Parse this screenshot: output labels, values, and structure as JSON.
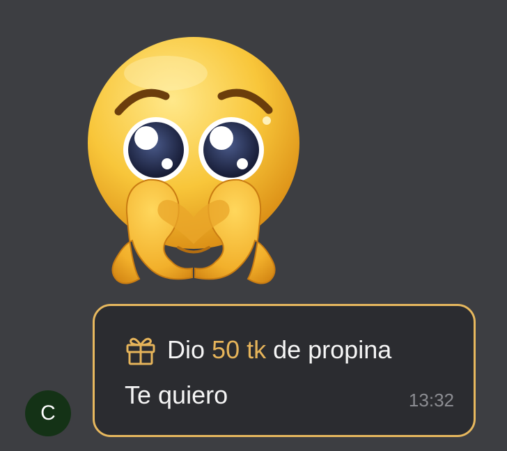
{
  "sticker": {
    "icon": "pleading-face-heart-hands-emoji"
  },
  "avatar": {
    "initial": "C",
    "color": "#143216"
  },
  "bubble": {
    "border_color": "#e7b85e",
    "gift_icon": "gift-icon",
    "tip_prefix": "Dio",
    "tip_amount": "50 tk",
    "tip_suffix": "de propina",
    "message": "Te quiero",
    "time": "13:32"
  },
  "colors": {
    "background": "#3d3e42",
    "accent": "#e6b45a",
    "text": "#f5f5f5",
    "timestamp": "#8c8d92"
  }
}
